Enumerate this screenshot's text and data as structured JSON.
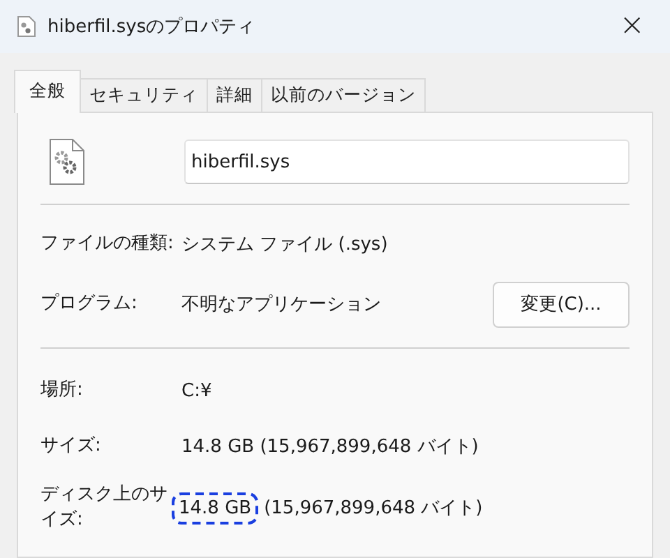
{
  "window": {
    "title": "hiberfil.sysのプロパティ",
    "close": "×"
  },
  "tabs": [
    {
      "label": "全般",
      "selected": true
    },
    {
      "label": "セキュリティ",
      "selected": false
    },
    {
      "label": "詳細",
      "selected": false
    },
    {
      "label": "以前のバージョン",
      "selected": false
    }
  ],
  "file_name": {
    "value": "hiberfil.sys"
  },
  "type_rows": [
    {
      "label": "ファイルの種類:",
      "parts": [
        {
          "text": "システム ファイル (.sys)",
          "highlighted": false
        }
      ]
    },
    {
      "label": "プログラム:",
      "parts": [
        {
          "text": "不明なアプリケーション",
          "highlighted": false
        }
      ],
      "button": "変更(C)..."
    }
  ],
  "location_rows": [
    {
      "label": "場所:",
      "parts": [
        {
          "text": "C:¥",
          "highlighted": false
        }
      ]
    },
    {
      "label": "サイズ:",
      "parts": [
        {
          "text": "14.8 GB (15,967,899,648 バイト)",
          "highlighted": false
        }
      ]
    },
    {
      "label": "ディスク上のサイズ:",
      "parts": [
        {
          "text": "14.8 GB",
          "highlighted": true
        },
        {
          "text": "(15,967,899,648 バイト)",
          "highlighted": false
        }
      ]
    }
  ]
}
